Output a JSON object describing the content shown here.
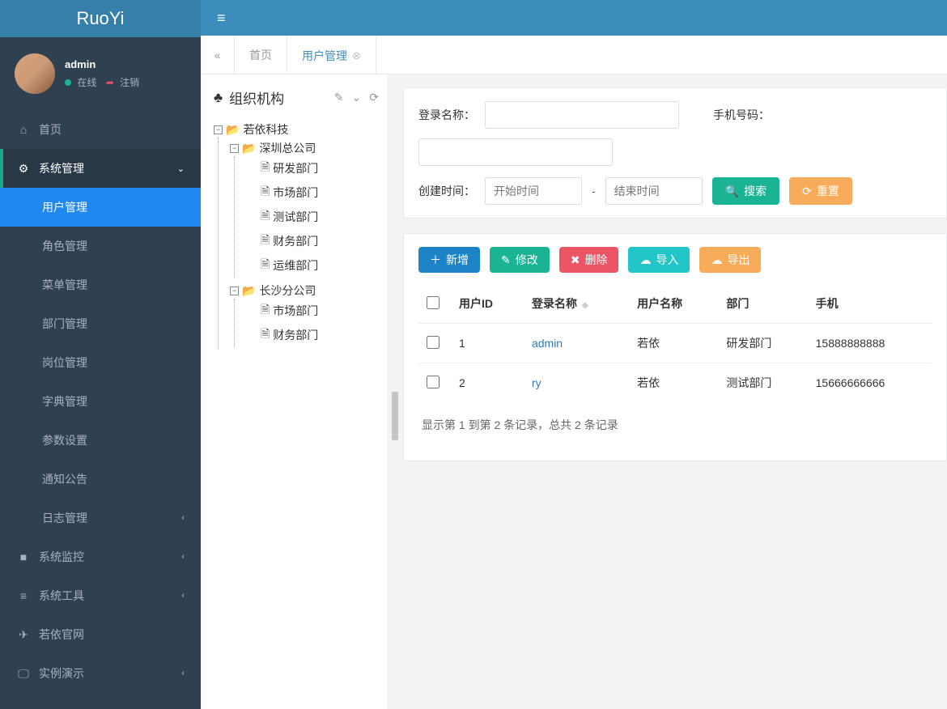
{
  "brand": "RuoYi",
  "user": {
    "name": "admin",
    "status": "在线",
    "logout": "注销"
  },
  "nav": {
    "home": "首页",
    "system": "系统管理",
    "monitor": "系统监控",
    "tools": "系统工具",
    "site": "若依官网",
    "demo": "实例演示",
    "system_children": {
      "user": "用户管理",
      "role": "角色管理",
      "menu": "菜单管理",
      "dept": "部门管理",
      "post": "岗位管理",
      "dict": "字典管理",
      "config": "参数设置",
      "notice": "通知公告",
      "log": "日志管理"
    }
  },
  "tabs": {
    "home": "首页",
    "userMgmt": "用户管理"
  },
  "tree": {
    "title": "组织机构",
    "root": "若依科技",
    "shenzhen": "深圳总公司",
    "sz_children": {
      "rd": "研发部门",
      "mk": "市场部门",
      "test": "测试部门",
      "fin": "财务部门",
      "ops": "运维部门"
    },
    "changsha": "长沙分公司",
    "cs_children": {
      "mk": "市场部门",
      "fin": "财务部门"
    }
  },
  "search": {
    "loginLabel": "登录名称：",
    "phoneLabel": "手机号码：",
    "timeLabel": "创建时间：",
    "startPlaceholder": "开始时间",
    "endPlaceholder": "结束时间",
    "searchBtn": "搜索",
    "resetBtn": "重置"
  },
  "toolbar": {
    "add": "新增",
    "edit": "修改",
    "del": "删除",
    "import": "导入",
    "export": "导出"
  },
  "table": {
    "cols": {
      "userId": "用户ID",
      "login": "登录名称",
      "userName": "用户名称",
      "dept": "部门",
      "phone": "手机"
    },
    "rows": [
      {
        "id": "1",
        "login": "admin",
        "name": "若依",
        "dept": "研发部门",
        "phone": "15888888888"
      },
      {
        "id": "2",
        "login": "ry",
        "name": "若依",
        "dept": "测试部门",
        "phone": "15666666666"
      }
    ]
  },
  "footer": "显示第 1 到第 2 条记录，总共 2 条记录"
}
